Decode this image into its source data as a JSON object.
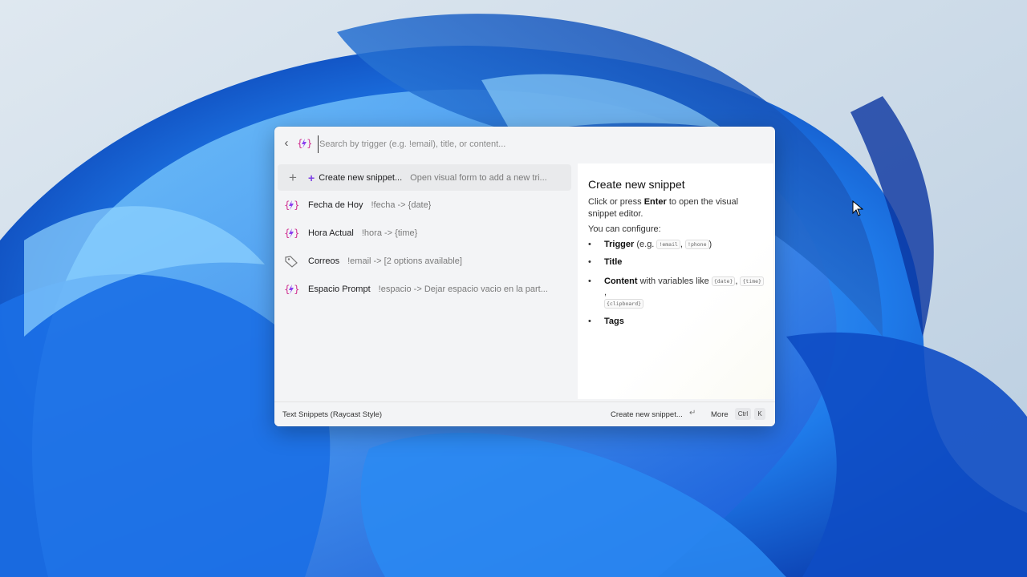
{
  "colors": {
    "accent": "#7b3fe4",
    "desktop_blue": "#1a6ce0",
    "window_bg": "#f3f4f6"
  },
  "search": {
    "placeholder": "Search by trigger (e.g. !email), title, or content...",
    "value": "",
    "back_icon": "chevron-left-icon",
    "extension_icon": "lightning-braces-icon"
  },
  "list": {
    "items": [
      {
        "icon": "plus-icon",
        "title": "Create new snippet...",
        "subtitle": "Open visual form to add a new tri...",
        "selected": true
      },
      {
        "icon": "lightning-braces-icon",
        "title": "Fecha de Hoy",
        "subtitle": "!fecha -> {date}"
      },
      {
        "icon": "lightning-braces-icon",
        "title": "Hora Actual",
        "subtitle": "!hora -> {time}"
      },
      {
        "icon": "tag-icon",
        "title": "Correos",
        "subtitle": "!email -> [2 options available]"
      },
      {
        "icon": "lightning-braces-icon",
        "title": "Espacio Prompt",
        "subtitle": "!espacio -> Dejar espacio vacio en la part..."
      }
    ]
  },
  "detail": {
    "heading": "Create new snippet",
    "desc_pre": "Click or press ",
    "desc_key": "Enter",
    "desc_post": " to open the visual snippet editor.",
    "configure": "You can configure:",
    "trigger_label": "Trigger",
    "trigger_pre": " (e.g. ",
    "trigger_ex1": "!email",
    "trigger_sep": ", ",
    "trigger_ex2": "!phone",
    "trigger_post": ")",
    "title_label": "Title",
    "content_label": "Content",
    "content_text": " with variables like ",
    "var_date": "{date}",
    "var_sep": ", ",
    "var_time": "{time}",
    "var_sep2": ", ",
    "var_clipboard": "{clipboard}",
    "tags_label": "Tags"
  },
  "footer": {
    "extension_name": "Text Snippets (Raycast Style)",
    "primary_action": "Create new snippet...",
    "enter_icon": "↵",
    "more_label": "More",
    "ctrl_key": "Ctrl",
    "k_key": "K"
  }
}
